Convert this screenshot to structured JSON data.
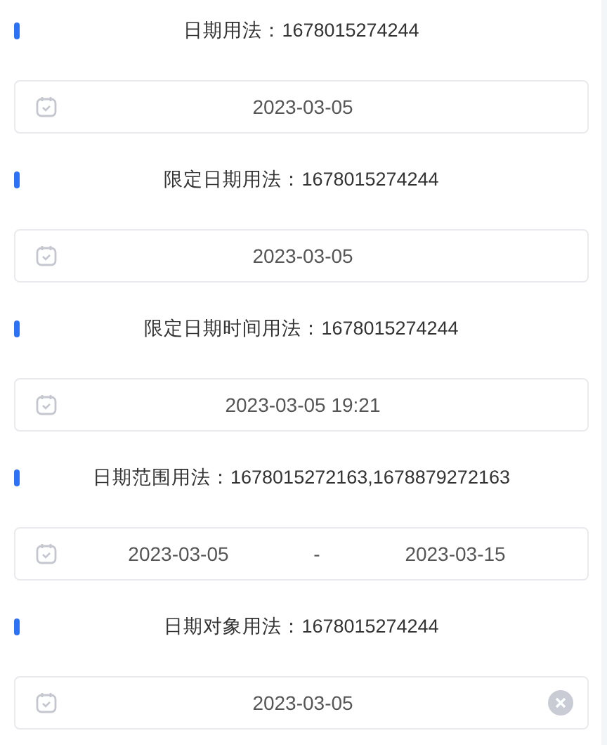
{
  "sections": [
    {
      "title": "日期用法：1678015274244",
      "picker": {
        "kind": "single",
        "value": "2023-03-05",
        "clearable": false
      }
    },
    {
      "title": "限定日期用法：1678015274244",
      "picker": {
        "kind": "single",
        "value": "2023-03-05",
        "clearable": false
      }
    },
    {
      "title": "限定日期时间用法：1678015274244",
      "picker": {
        "kind": "single",
        "value": "2023-03-05 19:21",
        "clearable": false
      }
    },
    {
      "title": "日期范围用法：1678015272163,1678879272163",
      "picker": {
        "kind": "range",
        "start": "2023-03-05",
        "separator": "-",
        "end": "2023-03-15",
        "clearable": false
      }
    },
    {
      "title": "日期对象用法：1678015274244",
      "picker": {
        "kind": "single",
        "value": "2023-03-05",
        "clearable": true
      }
    }
  ]
}
